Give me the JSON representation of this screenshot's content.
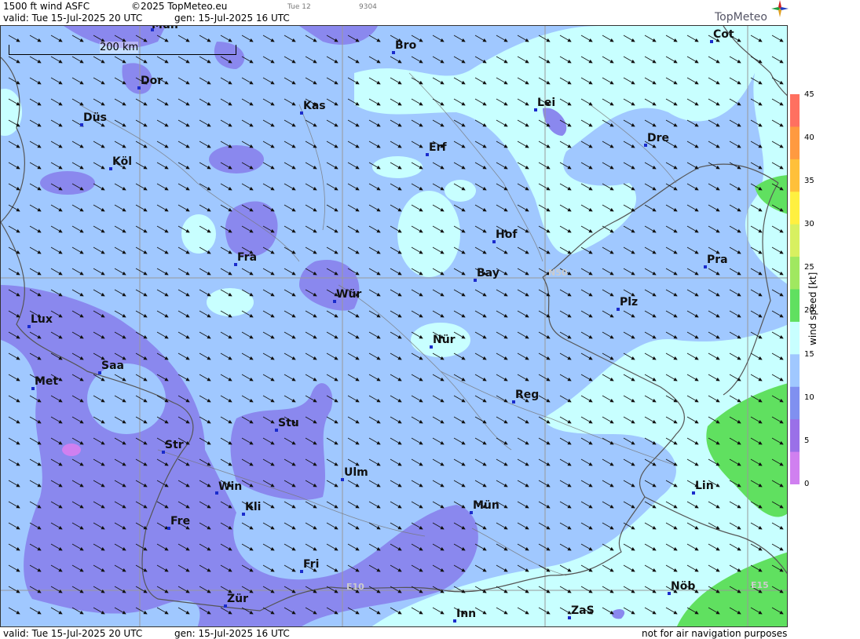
{
  "header": {
    "product": "1500 ft wind ASFC",
    "copyright": "©2025 TopMeteo.eu",
    "day_short": "Tue 12",
    "code": "9304",
    "valid": "valid:  Tue  15-Jul-2025  20 UTC",
    "gen": "gen: 15-Jul-2025 16 UTC",
    "logo": "TopMeteo"
  },
  "footer": {
    "valid": "valid:  Tue  15-Jul-2025  20 UTC",
    "gen": "gen: 15-Jul-2025 16 UTC",
    "disclaimer": "not for air navigation purposes"
  },
  "scale_label": "200 km",
  "grid_labels": {
    "n50": "N50",
    "e10": "E10",
    "e15": "E15"
  },
  "legend": {
    "title": "wind speed [kt]",
    "ticks": [
      "45",
      "40",
      "35",
      "30",
      "25",
      "20",
      "15",
      "10",
      "5",
      "0"
    ],
    "colors": [
      "#ff7060",
      "#ff9a40",
      "#ffc03a",
      "#fff040",
      "#d8f060",
      "#a0e860",
      "#60e060",
      "#c8ffff",
      "#a0c8ff",
      "#8090f0",
      "#9a70e8",
      "#d080f0"
    ]
  },
  "cities": [
    {
      "name": "Mün"
    },
    {
      "name": "Bro"
    },
    {
      "name": "Cot"
    },
    {
      "name": "Dor"
    },
    {
      "name": "Kas"
    },
    {
      "name": "Lei"
    },
    {
      "name": "Düs"
    },
    {
      "name": "Erf"
    },
    {
      "name": "Dre"
    },
    {
      "name": "Köl"
    },
    {
      "name": "Hof"
    },
    {
      "name": "Fra"
    },
    {
      "name": "Pra"
    },
    {
      "name": "Bay"
    },
    {
      "name": "Wür"
    },
    {
      "name": "Plz"
    },
    {
      "name": "Lux"
    },
    {
      "name": "Nür"
    },
    {
      "name": "Saa"
    },
    {
      "name": "Met"
    },
    {
      "name": "Reg"
    },
    {
      "name": "Stu"
    },
    {
      "name": "Str"
    },
    {
      "name": "Ulm"
    },
    {
      "name": "Lin"
    },
    {
      "name": "Win"
    },
    {
      "name": "Kli"
    },
    {
      "name": "Mün"
    },
    {
      "name": "Fre"
    },
    {
      "name": "Fri"
    },
    {
      "name": "Nöb"
    },
    {
      "name": "Zür"
    },
    {
      "name": "ZaS"
    },
    {
      "name": "Inn"
    }
  ]
}
